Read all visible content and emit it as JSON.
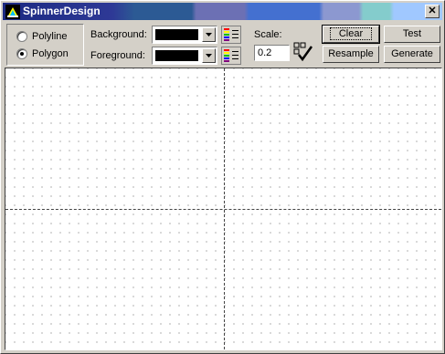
{
  "window": {
    "title": "SpinnerDesign",
    "close_symbol": "✕"
  },
  "shape_mode": {
    "options": [
      {
        "label": "Polyline",
        "selected": false
      },
      {
        "label": "Polygon",
        "selected": true
      }
    ]
  },
  "colors": {
    "background_label": "Background:",
    "foreground_label": "Foreground:",
    "background_value": "#000000",
    "foreground_value": "#000000"
  },
  "scale": {
    "label": "Scale:",
    "value": "0.2"
  },
  "buttons": {
    "clear": "Clear",
    "test": "Test",
    "resample": "Resample",
    "generate": "Generate"
  },
  "icons": {
    "app": "app-icon",
    "palette": "palette-icon",
    "apply_scale": "check-icon",
    "dropdown": "chevron-down-icon"
  }
}
